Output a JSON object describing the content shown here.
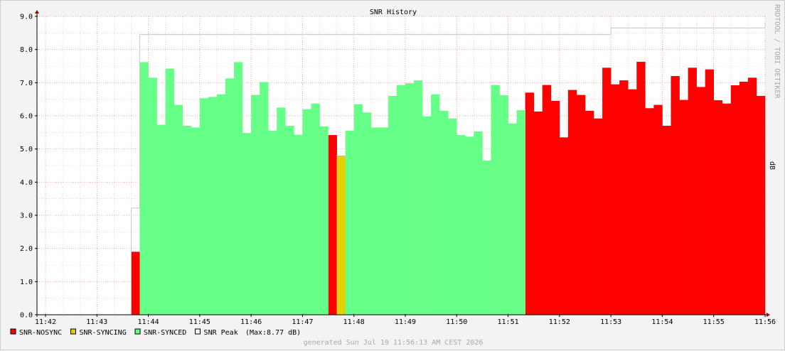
{
  "chart_data": {
    "type": "area",
    "title": "SNR History",
    "ylabel": "dB",
    "side_label": "RRDTOOL / TOBI OETIKER",
    "ylim": [
      0,
      9
    ],
    "y_ticks": [
      "0.0",
      "1.0",
      "2.0",
      "3.0",
      "4.0",
      "5.0",
      "6.0",
      "7.0",
      "8.0",
      "9.0"
    ],
    "x_ticks": [
      "11:42",
      "11:43",
      "11:44",
      "11:45",
      "11:46",
      "11:47",
      "11:48",
      "11:49",
      "11:50",
      "11:51",
      "11:52",
      "11:53",
      "11:54",
      "11:55",
      "11:56"
    ],
    "colors": {
      "nosync": "#ff0000",
      "syncing": "#e0d000",
      "synced": "#66ff88",
      "peak": "#c8c8c8"
    },
    "series": [
      {
        "name": "SNR-NOSYNC",
        "segments": [
          {
            "start": "11:43:40",
            "step_seconds": 10,
            "values": [
              1.9
            ]
          },
          {
            "start": "11:47:30",
            "step_seconds": 10,
            "values": [
              5.42
            ]
          },
          {
            "start": "11:51:20",
            "step_seconds": 10,
            "values": [
              6.7,
              6.13,
              6.93,
              6.45,
              5.35,
              6.78,
              6.63,
              6.15,
              5.92,
              7.45,
              6.95,
              7.07,
              6.8,
              7.63,
              6.23,
              6.33,
              5.7,
              7.2,
              6.48,
              7.45,
              6.87,
              7.4,
              6.47,
              6.37,
              6.92,
              7.03,
              7.15,
              6.6
            ]
          }
        ]
      },
      {
        "name": "SNR-SYNCING",
        "segments": [
          {
            "start": "11:47:40",
            "step_seconds": 10,
            "values": [
              4.8
            ]
          }
        ]
      },
      {
        "name": "SNR-SYNCED",
        "segments": [
          {
            "start": "11:43:50",
            "step_seconds": 10,
            "values": [
              7.62,
              7.15,
              5.73,
              7.42,
              6.33,
              5.7,
              5.65,
              6.53,
              6.57,
              6.65,
              7.13,
              7.62,
              5.48,
              6.63,
              7.02,
              5.55,
              6.25,
              5.7,
              5.43,
              6.2,
              6.37,
              5.68
            ]
          },
          {
            "start": "11:47:50",
            "step_seconds": 10,
            "values": [
              5.55,
              6.35,
              6.1,
              5.65,
              5.65,
              6.6,
              6.93,
              6.98,
              7.07,
              5.98,
              6.65,
              6.15,
              5.92,
              5.42,
              5.37,
              5.53,
              4.65,
              6.93,
              6.62,
              5.77,
              6.17
            ]
          }
        ]
      },
      {
        "name": "SNR Peak",
        "points": [
          [
            "11:43:40",
            3.22
          ],
          [
            "11:43:50",
            8.45
          ],
          [
            "11:52:50",
            8.45
          ],
          [
            "11:53:00",
            8.65
          ],
          [
            "11:55:50",
            8.65
          ],
          [
            "11:56:00",
            8.77
          ]
        ]
      }
    ],
    "legend": {
      "placement": "bottom-left",
      "items": [
        "SNR-NOSYNC",
        "SNR-SYNCING",
        "SNR-SYNCED",
        "SNR Peak"
      ],
      "peak_note": "(Max:8.77 dB)"
    },
    "footer": "generated Sun Jul 19 11:56:13 AM CEST 2026",
    "grid": true
  }
}
